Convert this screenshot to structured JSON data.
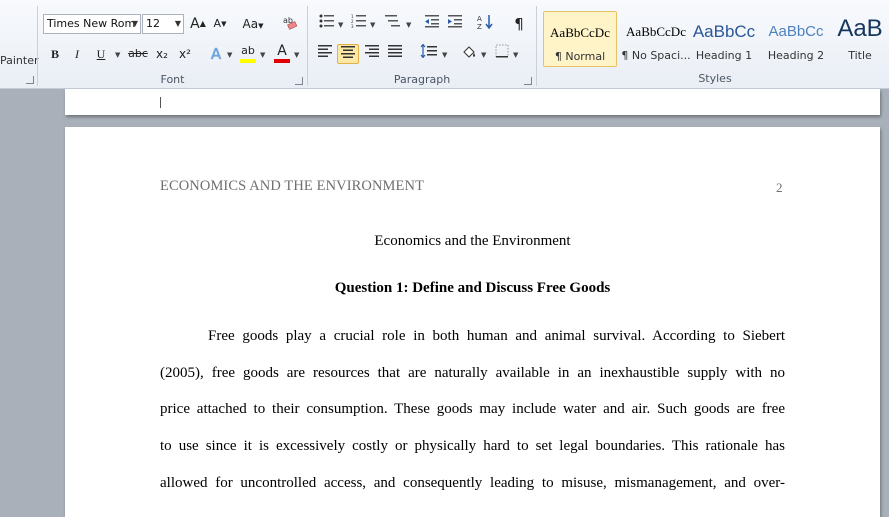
{
  "ribbon": {
    "clipboard": {
      "format_painter_label": "Painter"
    },
    "font": {
      "label": "Font",
      "font_name": "Times New Rom",
      "font_size": "12",
      "grow_font": "A",
      "shrink_font": "A",
      "change_case": "Aa",
      "bold": "B",
      "italic": "I",
      "underline": "U",
      "strikethrough": "abc",
      "subscript": "x₂",
      "superscript": "x²",
      "text_effects": "A",
      "highlight": "ab",
      "font_color": "A"
    },
    "paragraph": {
      "label": "Paragraph",
      "pilcrow": "¶"
    },
    "styles": {
      "label": "Styles",
      "items": [
        {
          "preview": "AaBbCcDc",
          "name": "¶ Normal"
        },
        {
          "preview": "AaBbCcDc",
          "name": "¶ No Spaci..."
        },
        {
          "preview": "AaBbCc",
          "name": "Heading 1"
        },
        {
          "preview": "AaBbCc",
          "name": "Heading 2"
        },
        {
          "preview": "AaB",
          "name": "Title"
        }
      ]
    },
    "colors": {
      "highlight": "#ffff00",
      "font_color": "#e00000",
      "heading_blue": "#1f497d"
    }
  },
  "document": {
    "header_left": "ECONOMICS AND THE ENVIRONMENT",
    "page_number": "2",
    "title": "Economics and the Environment",
    "heading": "Question 1: Define and Discuss Free Goods",
    "paragraph_lines": [
      "Free goods play a crucial role in both human and animal survival. According to Siebert",
      "(2005), free goods are resources that are naturally available in an inexhaustible supply with no",
      "price attached to their consumption. These goods may include water and air. Such goods are free",
      "to use since it is excessively costly or physically hard to set legal boundaries. This rationale has",
      "allowed for uncontrolled access, and consequently leading to misuse, mismanagement, and over-"
    ]
  }
}
